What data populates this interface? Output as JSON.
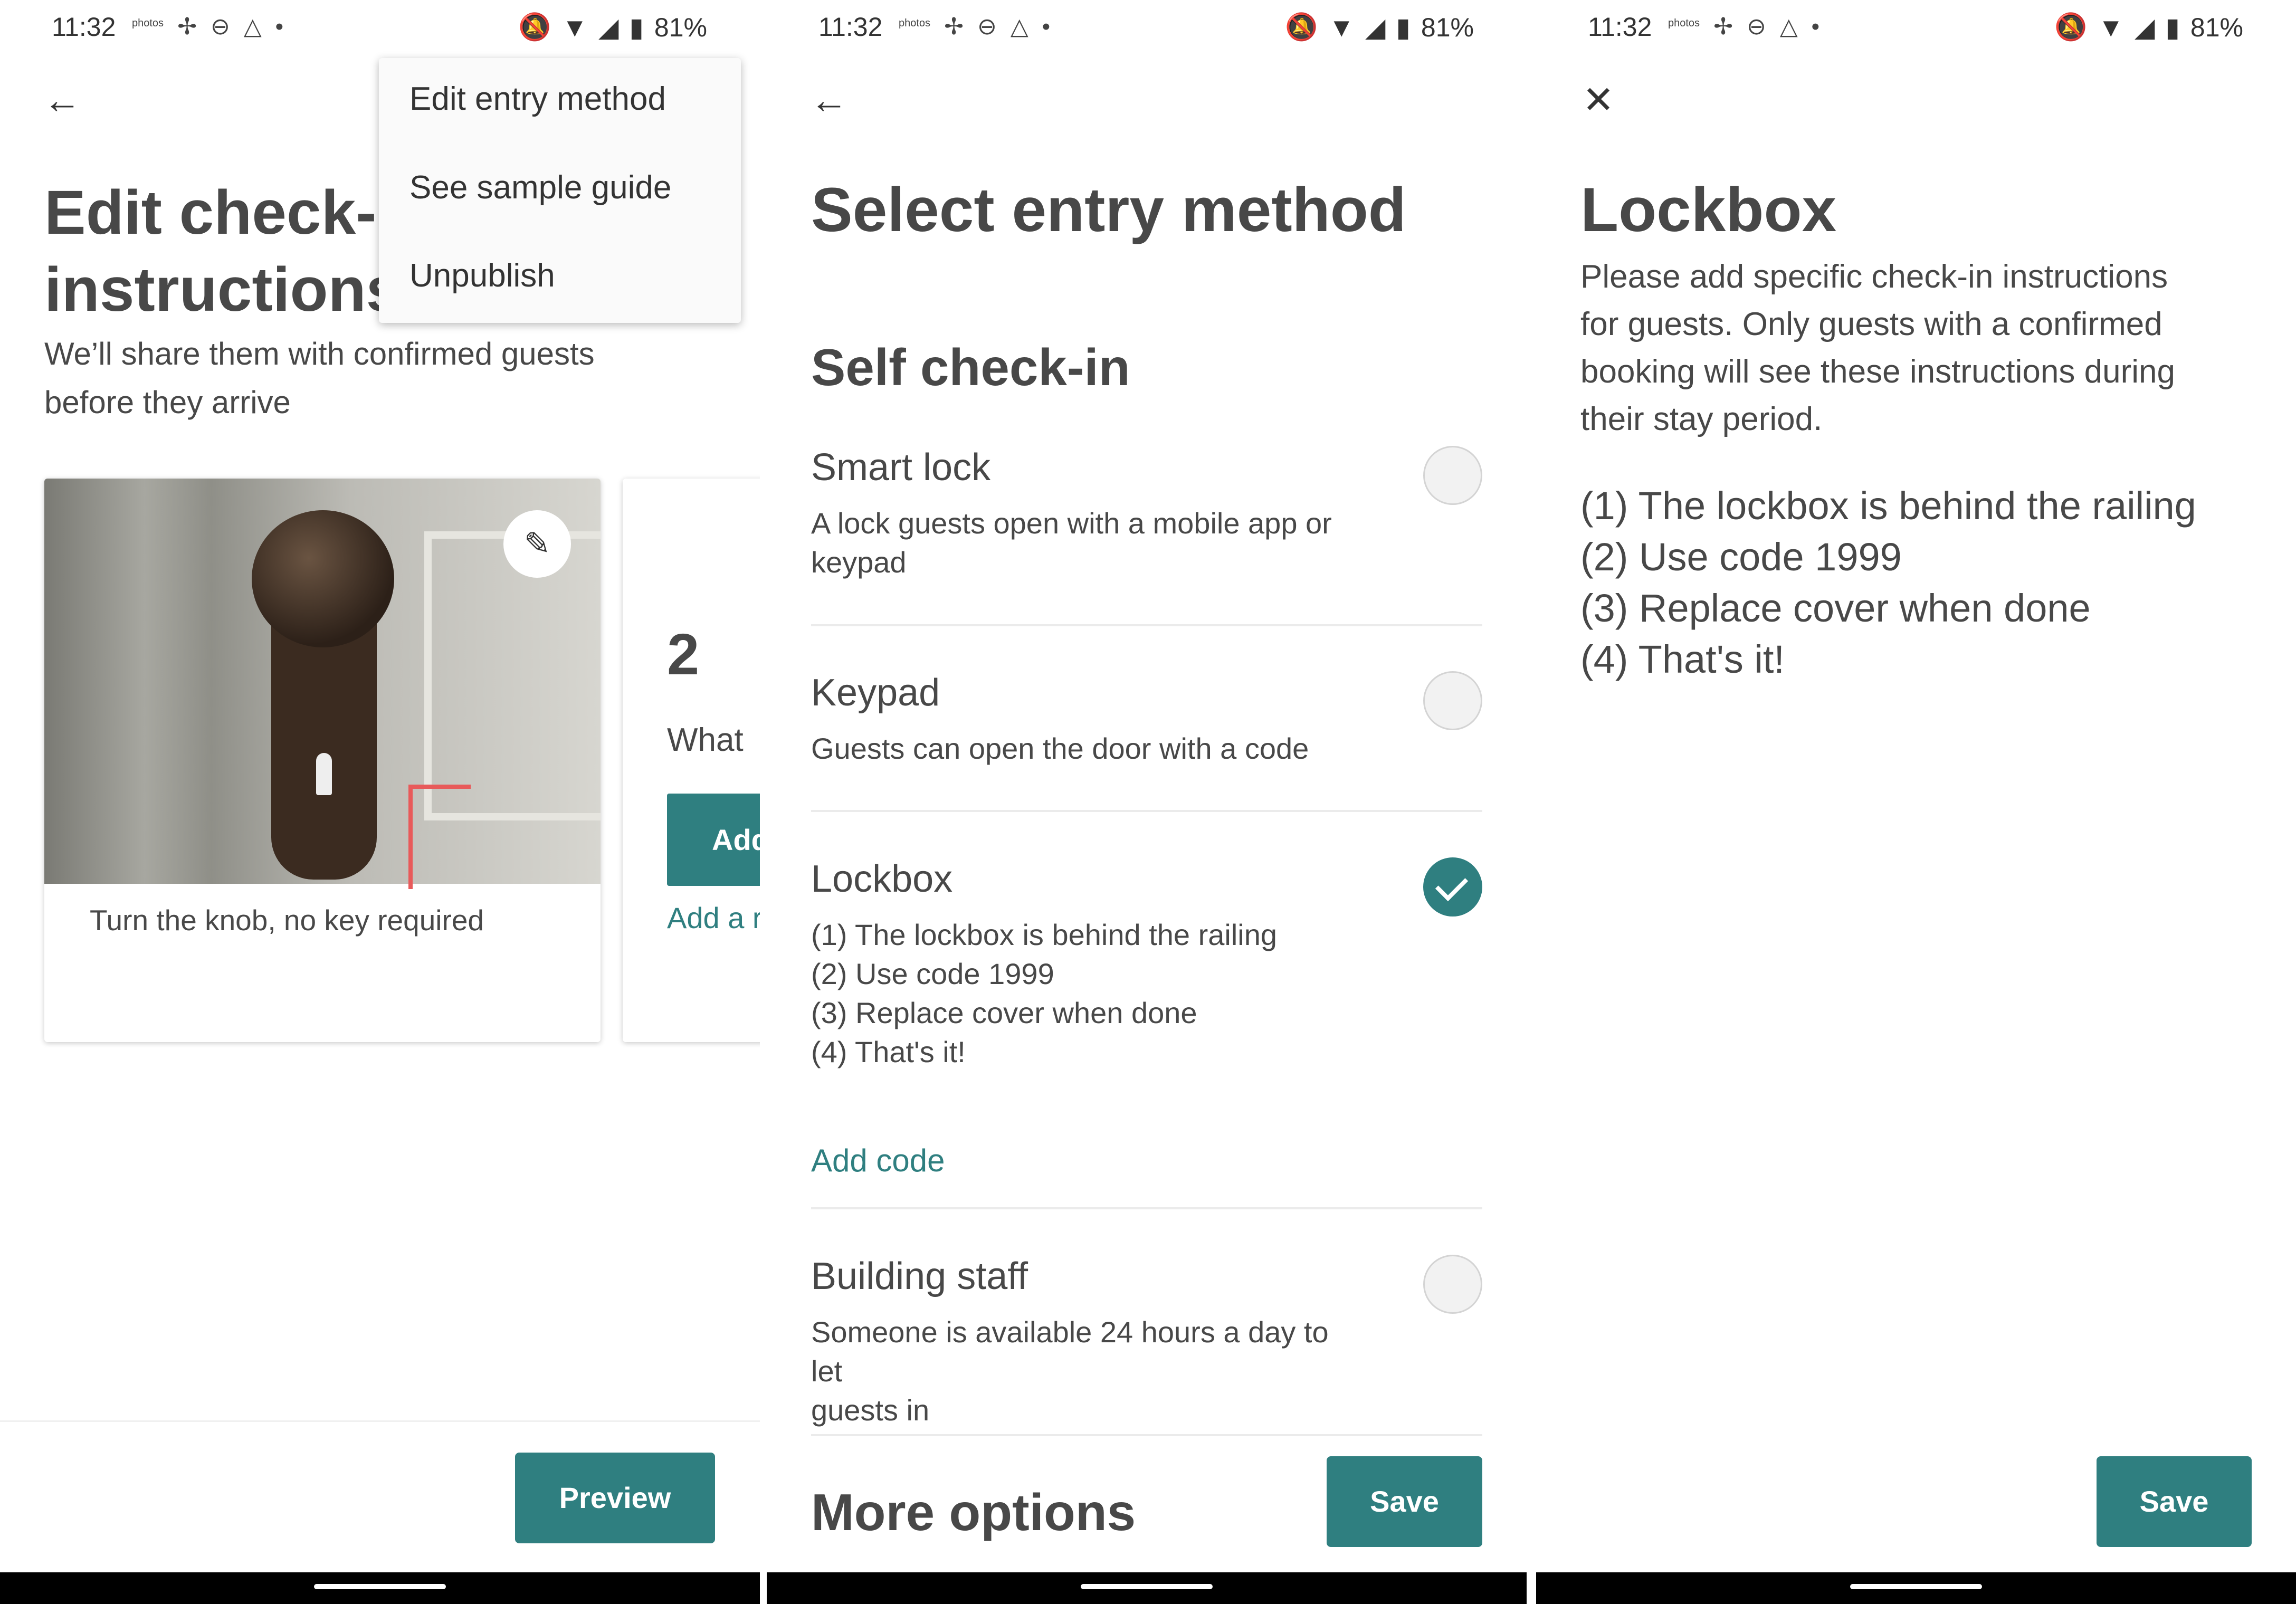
{
  "status_bar": {
    "time": "11:32",
    "battery": "81%",
    "app_icons": [
      "photos-icon",
      "pinwheel-icon",
      "circle-app-icon",
      "airbnb-icon"
    ]
  },
  "colors": {
    "accent": "#2f7f80",
    "text": "#484848"
  },
  "screen1": {
    "title_line1": "Edit check-in",
    "title_line2": "instructions",
    "subtitle_line1": "We’ll share them with confirmed guests",
    "subtitle_line2": "before they arrive",
    "menu": {
      "items": [
        "Edit entry method",
        "See sample guide",
        "Unpublish"
      ]
    },
    "card1": {
      "caption": "Turn the knob, no key required"
    },
    "card2": {
      "number": "2",
      "question": "What",
      "button_label": "Add",
      "link_label": "Add a r"
    },
    "preview_button": "Preview"
  },
  "screen2": {
    "title": "Select entry method",
    "section": "Self check-in",
    "options": [
      {
        "name": "Smart lock",
        "desc_line1": "A lock guests open with a mobile app or",
        "desc_line2": "keypad",
        "selected": false
      },
      {
        "name": "Keypad",
        "desc_line1": "Guests can open the door with a code",
        "selected": false
      },
      {
        "name": "Lockbox",
        "desc_line1": "(1) The lockbox is behind the railing",
        "desc_line2": "(2) Use code 1999",
        "desc_line3": "(3) Replace cover when done",
        "desc_line4": "(4) That's it!",
        "selected": true
      },
      {
        "name": "Building staff",
        "desc_line1": "Someone is available 24 hours a day to let",
        "desc_line2": "guests in",
        "selected": false
      }
    ],
    "add_code_link": "Add code",
    "more_options": "More options",
    "save_button": "Save"
  },
  "screen3": {
    "title": "Lockbox",
    "desc_line1": "Please add specific check-in instructions",
    "desc_line2": "for guests. Only guests with a confirmed",
    "desc_line3": "booking will see these instructions during",
    "desc_line4": "their stay period.",
    "steps": [
      "(1) The lockbox is behind the railing",
      "(2) Use code 1999",
      "(3) Replace cover when done",
      "(4) That's it!"
    ],
    "save_button": "Save"
  }
}
